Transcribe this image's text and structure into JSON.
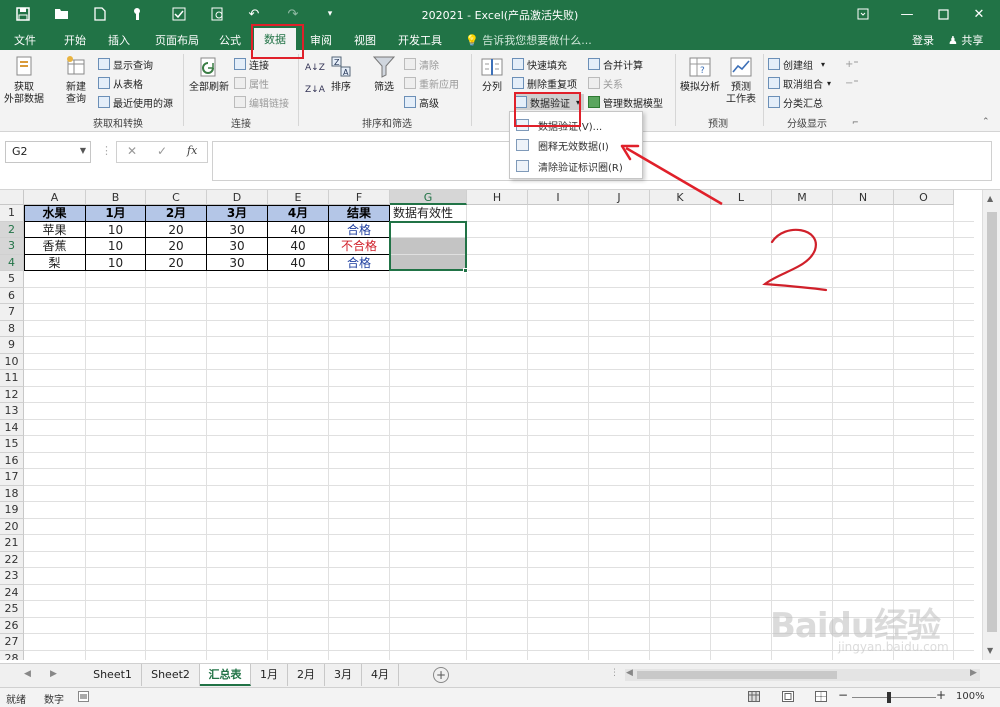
{
  "window": {
    "title": "202021 - Excel(产品激活失败)"
  },
  "quick_access": {
    "icons": [
      "save-icon",
      "open-icon",
      "new-icon",
      "touch-mode-icon",
      "spelling-icon",
      "print-preview-icon",
      "undo-icon",
      "redo-icon",
      "customize-icon"
    ]
  },
  "tabs": {
    "file": "文件",
    "home": "开始",
    "insert": "插入",
    "layout": "页面布局",
    "formulas": "公式",
    "data": "数据",
    "review": "审阅",
    "view": "视图",
    "developer": "开发工具",
    "tell_me": "告诉我您想要做什么...",
    "login": "登录",
    "share": "共享"
  },
  "ribbon": {
    "get_transform": {
      "get_external": "获取\n外部数据",
      "new_query": "新建\n查询",
      "show_queries": "显示查询",
      "from_table": "从表格",
      "recent_sources": "最近使用的源",
      "label": "获取和转换"
    },
    "connections": {
      "refresh_all": "全部刷新",
      "connections": "连接",
      "properties": "属性",
      "edit_links": "编辑链接",
      "label": "连接"
    },
    "sort_filter": {
      "sort": "排序",
      "filter": "筛选",
      "clear": "清除",
      "reapply": "重新应用",
      "advanced": "高级",
      "label": "排序和筛选"
    },
    "data_tools": {
      "split": "分列",
      "flash_fill": "快速填充",
      "remove_dup": "删除重复项",
      "validation": "数据验证",
      "consolidate": "合并计算",
      "relationships": "关系",
      "manage_model": "管理数据模型"
    },
    "forecast": {
      "what_if": "模拟分析",
      "sheet": "预测\n工作表",
      "label": "预测"
    },
    "outline": {
      "group": "创建组",
      "ungroup": "取消组合",
      "subtotal": "分类汇总",
      "label": "分级显示"
    }
  },
  "dropdown": {
    "items": [
      "数据验证(V)...",
      "圈释无效数据(I)",
      "清除验证标识圈(R)"
    ]
  },
  "formula_bar": {
    "name_box": "G2",
    "cancel": "✕",
    "enter": "✓",
    "fx": "fx",
    "value": ""
  },
  "grid": {
    "columns": [
      "A",
      "B",
      "C",
      "D",
      "E",
      "F",
      "G",
      "H",
      "I",
      "J",
      "K",
      "L",
      "M",
      "N",
      "O"
    ],
    "rows": [
      "1",
      "2",
      "3",
      "4",
      "5",
      "6",
      "7",
      "8",
      "9",
      "10",
      "11",
      "12",
      "13",
      "14",
      "15",
      "16",
      "17",
      "18",
      "19",
      "20",
      "21",
      "22",
      "23",
      "24",
      "25",
      "26",
      "27",
      "28"
    ],
    "headers": [
      "水果",
      "1月",
      "2月",
      "3月",
      "4月",
      "结果",
      "数据有效性"
    ],
    "data": [
      [
        "苹果",
        "10",
        "20",
        "30",
        "40",
        "合格",
        ""
      ],
      [
        "香蕉",
        "10",
        "20",
        "30",
        "40",
        "不合格",
        ""
      ],
      [
        "梨",
        "10",
        "20",
        "30",
        "40",
        "合格",
        ""
      ]
    ],
    "colors": {
      "pass": "#1f3fa0",
      "fail": "#d0202a",
      "header_fill": "#b4c6e7",
      "selection_fill": "#c4c4c4"
    }
  },
  "sheets": {
    "tabs": [
      "Sheet1",
      "Sheet2",
      "汇总表",
      "1月",
      "2月",
      "3月",
      "4月"
    ],
    "active": "汇总表"
  },
  "status": {
    "ready": "就绪",
    "mode": "数字",
    "zoom": "100%"
  },
  "annotation": {
    "step_number": "2"
  },
  "watermark": {
    "brand": "Baidu经验",
    "url": "jingyan.baidu.com"
  },
  "theme": {
    "accent": "#217346",
    "annotation_red": "#e0202a"
  }
}
